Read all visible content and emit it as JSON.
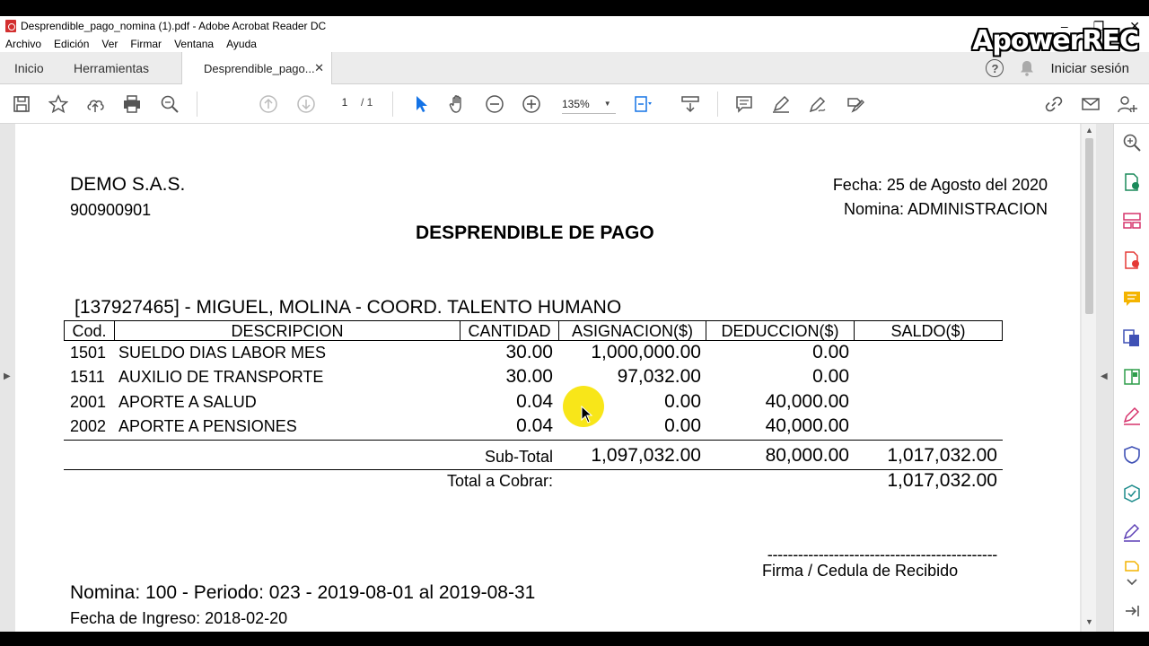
{
  "window": {
    "title": "Desprendible_pago_nomina (1).pdf - Adobe Acrobat Reader DC",
    "controls": [
      "–",
      "❐",
      "✕"
    ],
    "watermark": "ApowerREC"
  },
  "menu": [
    "Archivo",
    "Edición",
    "Ver",
    "Firmar",
    "Ventana",
    "Ayuda"
  ],
  "tabs": {
    "home": "Inicio",
    "tools": "Herramientas",
    "document": "Desprendible_pago...",
    "close": "✕",
    "help": "?",
    "login": "Iniciar sesión"
  },
  "toolbar": {
    "page_current": "1",
    "page_total": "/ 1",
    "zoom": "135%"
  },
  "document": {
    "company": "DEMO S.A.S.",
    "nit": "900900901",
    "date": "Fecha: 25 de Agosto del 2020",
    "payroll": "Nomina: ADMINISTRACION",
    "title": "DESPRENDIBLE DE PAGO",
    "employee": "[137927465] -  MIGUEL,  MOLINA - COORD. TALENTO HUMANO",
    "headers": [
      "Cod.",
      "DESCRIPCION",
      "CANTIDAD",
      "ASIGNACION($)",
      "DEDUCCION($)",
      "SALDO($)"
    ],
    "rows": [
      {
        "cod": "1501",
        "desc": "SUELDO DIAS LABOR MES",
        "qty": "30.00",
        "asig": "1,000,000.00",
        "ded": "0.00"
      },
      {
        "cod": "1511",
        "desc": "AUXILIO DE TRANSPORTE",
        "qty": "30.00",
        "asig": "97,032.00",
        "ded": "0.00"
      },
      {
        "cod": "2001",
        "desc": "APORTE A SALUD",
        "qty": "0.04",
        "asig": "0.00",
        "ded": "40,000.00"
      },
      {
        "cod": "2002",
        "desc": "APORTE A PENSIONES",
        "qty": "0.04",
        "asig": "0.00",
        "ded": "40,000.00"
      }
    ],
    "subtotal_label": "Sub-Total",
    "subtotal_asig": "1,097,032.00",
    "subtotal_ded": "80,000.00",
    "subtotal_saldo": "1,017,032.00",
    "total_label": "Total a Cobrar:",
    "total_value": "1,017,032.00",
    "signature_line": "---------------------------------------------",
    "signature_label": "Firma / Cedula de Recibido",
    "period": "Nomina: 100 - Periodo: 023 - 2019-08-01 al 2019-08-31",
    "hire_date": "Fecha de Ingreso: 2018-02-20"
  },
  "colors": {
    "accent": "#1473e6",
    "highlight": "#f7e300"
  }
}
